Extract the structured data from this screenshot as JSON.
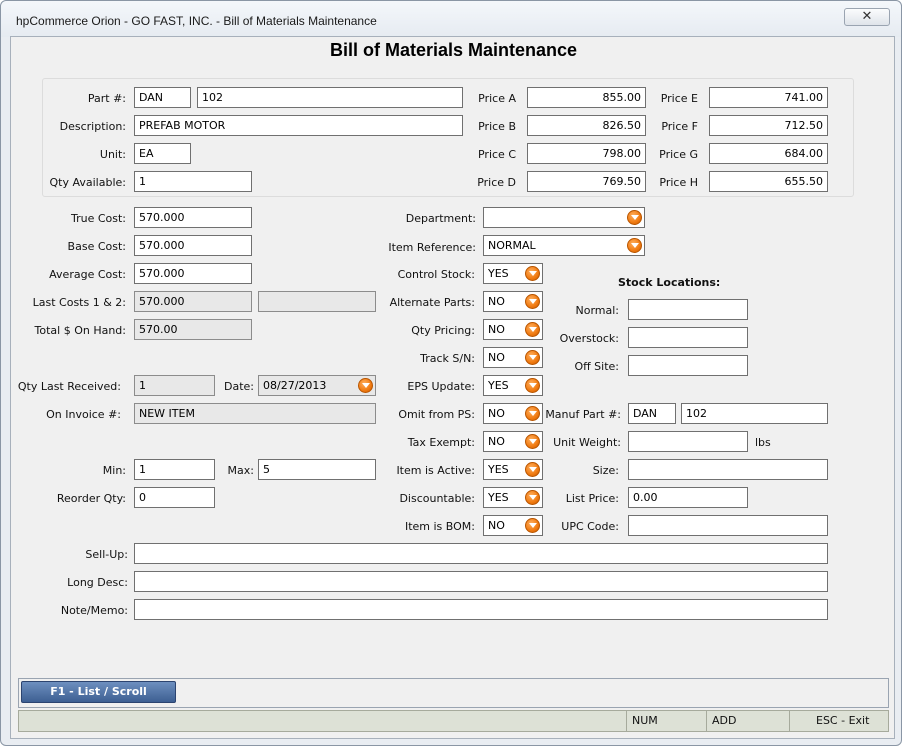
{
  "window": {
    "title": "hpCommerce Orion - GO FAST, INC. - Bill of Materials Maintenance",
    "close_glyph": "✕"
  },
  "form": {
    "title": "Bill of Materials Maintenance"
  },
  "header": {
    "part_label": "Part #:",
    "part_prefix": "DAN",
    "part_number": "102",
    "description_label": "Description:",
    "description": "PREFAB MOTOR",
    "unit_label": "Unit:",
    "unit": "EA",
    "qty_available_label": "Qty Available:",
    "qty_available": "1"
  },
  "prices": [
    {
      "label": "Price A",
      "value": "855.00"
    },
    {
      "label": "Price B",
      "value": "826.50"
    },
    {
      "label": "Price C",
      "value": "798.00"
    },
    {
      "label": "Price D",
      "value": "769.50"
    },
    {
      "label": "Price E",
      "value": "741.00"
    },
    {
      "label": "Price F",
      "value": "712.50"
    },
    {
      "label": "Price G",
      "value": "684.00"
    },
    {
      "label": "Price H",
      "value": "655.50"
    }
  ],
  "costs": {
    "true_cost_label": "True Cost:",
    "true_cost": "570.000",
    "base_cost_label": "Base Cost:",
    "base_cost": "570.000",
    "average_cost_label": "Average Cost:",
    "average_cost": "570.000",
    "last_costs_label": "Last Costs 1 & 2:",
    "last_cost_1": "570.000",
    "last_cost_2": "",
    "total_on_hand_label": "Total $ On Hand:",
    "total_on_hand": "570.00"
  },
  "receiving": {
    "qty_last_received_label": "Qty Last Received:",
    "qty_last_received": "1",
    "date_label": "Date:",
    "date": "08/27/2013",
    "on_invoice_label": "On Invoice #:",
    "on_invoice": "NEW ITEM"
  },
  "stock_levels": {
    "min_label": "Min:",
    "min": "1",
    "max_label": "Max:",
    "max": "5",
    "reorder_qty_label": "Reorder Qty:",
    "reorder_qty": "0"
  },
  "attributes": {
    "department_label": "Department:",
    "department": "",
    "item_reference_label": "Item Reference:",
    "item_reference": "NORMAL",
    "flags": [
      {
        "label": "Control Stock:",
        "value": "YES"
      },
      {
        "label": "Alternate Parts:",
        "value": "NO"
      },
      {
        "label": "Qty Pricing:",
        "value": "NO"
      },
      {
        "label": "Track S/N:",
        "value": "NO"
      },
      {
        "label": "EPS Update:",
        "value": "YES"
      },
      {
        "label": "Omit from PS:",
        "value": "NO"
      },
      {
        "label": "Tax Exempt:",
        "value": "NO"
      },
      {
        "label": "Item is Active:",
        "value": "YES"
      },
      {
        "label": "Discountable:",
        "value": "YES"
      },
      {
        "label": "Item is BOM:",
        "value": "NO"
      }
    ]
  },
  "stock_locations": {
    "heading": "Stock Locations:",
    "normal_label": "Normal:",
    "normal": "",
    "overstock_label": "Overstock:",
    "overstock": "",
    "off_site_label": "Off Site:",
    "off_site": ""
  },
  "manufacturer": {
    "manuf_part_label": "Manuf Part #:",
    "manuf_prefix": "DAN",
    "manuf_part": "102",
    "unit_weight_label": "Unit Weight:",
    "unit_weight": "",
    "weight_unit": "lbs",
    "size_label": "Size:",
    "size": "",
    "list_price_label": "List Price:",
    "list_price": "0.00",
    "upc_label": "UPC Code:",
    "upc": ""
  },
  "notes": {
    "sell_up_label": "Sell-Up:",
    "sell_up": "",
    "long_desc_label": "Long Desc:",
    "long_desc": "",
    "note_memo_label": "Note/Memo:",
    "note_memo": ""
  },
  "toolbar": {
    "f1_label": "F1 - List / Scroll"
  },
  "status": {
    "main": "",
    "num": "NUM",
    "add": "ADD",
    "exit": "ESC - Exit"
  }
}
